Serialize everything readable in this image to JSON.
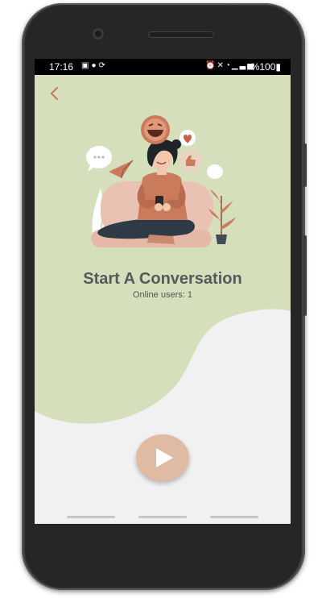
{
  "status_bar": {
    "time": "17:16",
    "left_icons": [
      "gallery-icon",
      "message-icon",
      "sync-icon"
    ],
    "right_icons": [
      "alarm-icon",
      "mute-icon",
      "wifi-icon",
      "signal-icon"
    ],
    "battery": "%100"
  },
  "screen": {
    "title": "Start A Conversation",
    "online_users": "Online users: 1"
  },
  "colors": {
    "background_green": "#d5dfbb",
    "background_light": "#f1f1f1",
    "accent": "#e0bba3",
    "back_arrow": "#c07a5a"
  }
}
